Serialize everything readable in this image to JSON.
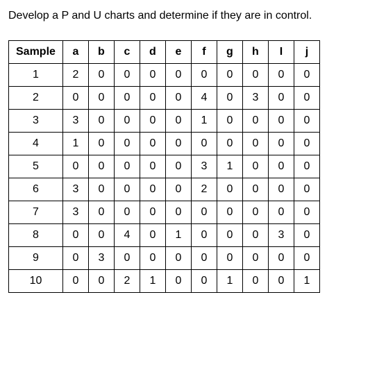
{
  "prompt_text": "Develop a P and U charts and determine if they are in control.",
  "table": {
    "header_sample": "Sample",
    "columns": [
      "a",
      "b",
      "c",
      "d",
      "e",
      "f",
      "g",
      "h",
      "I",
      "j"
    ],
    "rows": [
      {
        "label": "1",
        "values": [
          2,
          0,
          0,
          0,
          0,
          0,
          0,
          0,
          0,
          0
        ]
      },
      {
        "label": "2",
        "values": [
          0,
          0,
          0,
          0,
          0,
          4,
          0,
          3,
          0,
          0
        ]
      },
      {
        "label": "3",
        "values": [
          3,
          0,
          0,
          0,
          0,
          1,
          0,
          0,
          0,
          0
        ]
      },
      {
        "label": "4",
        "values": [
          1,
          0,
          0,
          0,
          0,
          0,
          0,
          0,
          0,
          0
        ]
      },
      {
        "label": "5",
        "values": [
          0,
          0,
          0,
          0,
          0,
          3,
          1,
          0,
          0,
          0
        ]
      },
      {
        "label": "6",
        "values": [
          3,
          0,
          0,
          0,
          0,
          2,
          0,
          0,
          0,
          0
        ]
      },
      {
        "label": "7",
        "values": [
          3,
          0,
          0,
          0,
          0,
          0,
          0,
          0,
          0,
          0
        ]
      },
      {
        "label": "8",
        "values": [
          0,
          0,
          4,
          0,
          1,
          0,
          0,
          0,
          3,
          0
        ]
      },
      {
        "label": "9",
        "values": [
          0,
          3,
          0,
          0,
          0,
          0,
          0,
          0,
          0,
          0
        ]
      },
      {
        "label": "10",
        "values": [
          0,
          0,
          2,
          1,
          0,
          0,
          1,
          0,
          0,
          1
        ]
      }
    ]
  }
}
